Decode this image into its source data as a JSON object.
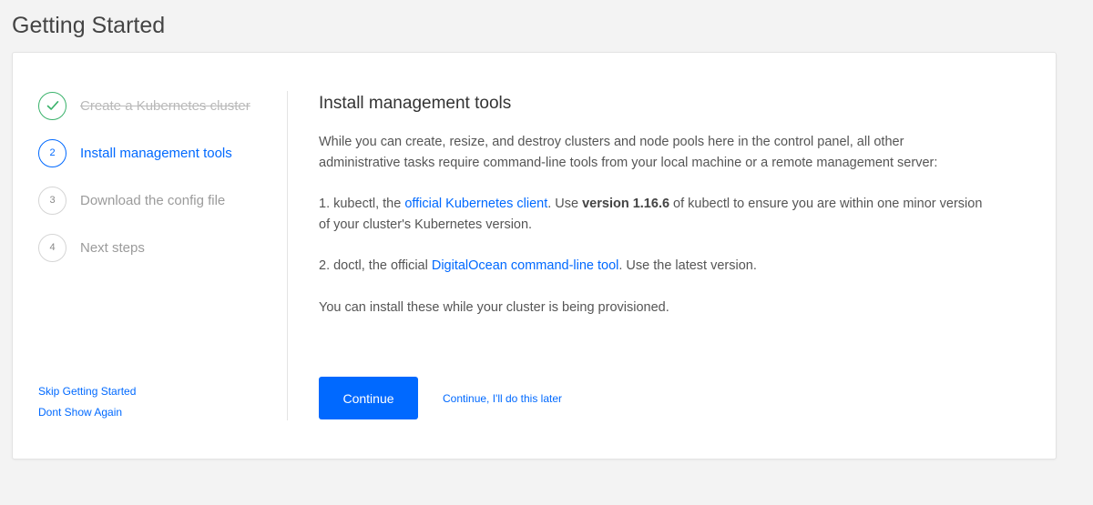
{
  "page": {
    "title": "Getting Started"
  },
  "steps": [
    {
      "number": "",
      "icon": "check-icon",
      "label": "Create a Kubernetes cluster",
      "state": "done"
    },
    {
      "number": "2",
      "label": "Install management tools",
      "state": "active"
    },
    {
      "number": "3",
      "label": "Download the config file",
      "state": "pending"
    },
    {
      "number": "4",
      "label": "Next steps",
      "state": "pending"
    }
  ],
  "side_links": {
    "skip": "Skip Getting Started",
    "dont_show": "Dont Show Again"
  },
  "content": {
    "heading": "Install management tools",
    "intro": "While you can create, resize, and destroy clusters and node pools here in the control panel, all other administrative tasks require command-line tools from your local machine or a remote management server:",
    "item1": {
      "prefix": "1. kubectl, the ",
      "link": "official Kubernetes client",
      "mid": ". Use ",
      "bold": "version 1.16.6",
      "suffix": " of kubectl to ensure you are within one minor version of your cluster's Kubernetes version."
    },
    "item2": {
      "prefix": "2. doctl, the official ",
      "link": "DigitalOcean command-line tool",
      "suffix": ". Use the latest version."
    },
    "note": "You can install these while your cluster is being provisioned."
  },
  "actions": {
    "continue": "Continue",
    "later": "Continue, I'll do this later"
  },
  "colors": {
    "accent": "#0069ff",
    "success": "#39b26a"
  }
}
